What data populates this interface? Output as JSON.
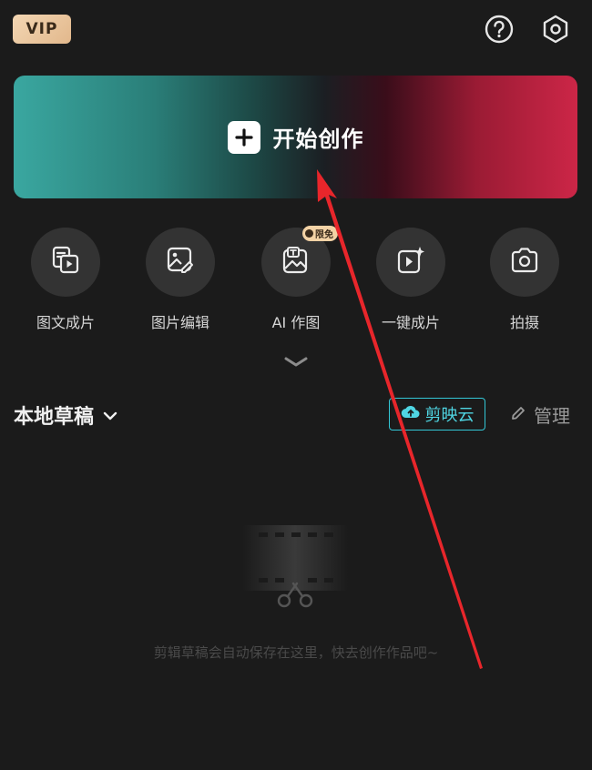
{
  "top_bar": {
    "vip_label": "VIP",
    "icons": [
      "help-icon",
      "settings-icon"
    ]
  },
  "banner": {
    "label": "开始创作",
    "icon": "plus-icon"
  },
  "tools": [
    {
      "label": "图文成片",
      "icon": "image-to-video-icon"
    },
    {
      "label": "图片编辑",
      "icon": "image-edit-icon"
    },
    {
      "label": "AI 作图",
      "icon": "ai-image-icon",
      "badge": "限免"
    },
    {
      "label": "一键成片",
      "icon": "one-click-video-icon"
    },
    {
      "label": "拍摄",
      "icon": "camera-icon"
    }
  ],
  "expand_icon": "chevron-down-icon",
  "drafts": {
    "title": "本地草稿",
    "cloud_button": "剪映云",
    "manage_label": "管理",
    "empty_text": "剪辑草稿会自动保存在这里，快去创作作品吧~"
  },
  "colors": {
    "background": "#1b1b1b",
    "accent_cyan": "#33c7d6",
    "banner_left": "#3aa7a0",
    "banner_right": "#cc2647",
    "annotation_arrow": "#e8262b"
  }
}
